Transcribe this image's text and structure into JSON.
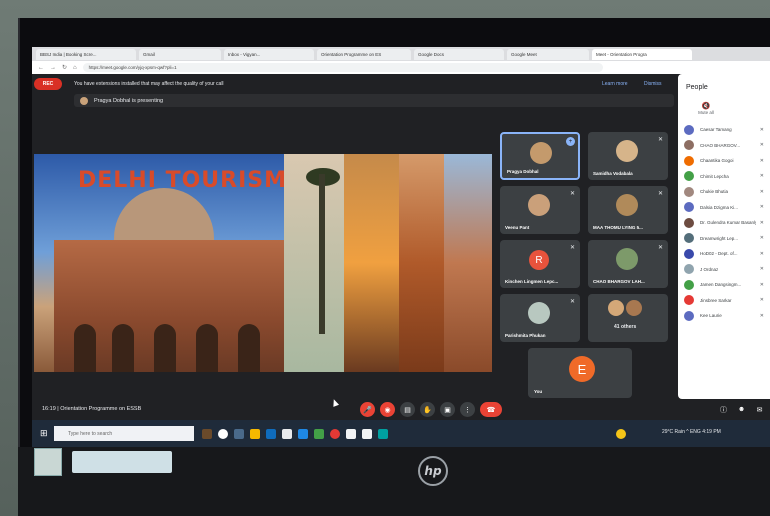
{
  "browser": {
    "tabs": [
      {
        "label": "BBSJ India | Booking Scre..."
      },
      {
        "label": "Gmail"
      },
      {
        "label": "Inbox - Vigyan..."
      },
      {
        "label": "Orientation Programme on ES"
      },
      {
        "label": "Google Docs"
      },
      {
        "label": "Google Meet"
      },
      {
        "label": "Meet - Orientation Progra"
      }
    ],
    "url": "https://meet.google.com/yjq-xpsm-qwf?pli=1"
  },
  "meet": {
    "rec_label": "REC",
    "notice_text": "You have extensions installed that may affect the quality of your call",
    "notice_learn_more": "Learn more",
    "notice_dismiss": "Dismiss",
    "presenting_text": "Pragya Dobhal is presenting",
    "slide_title": "DELHI TOURISM",
    "meeting_info": "16:19  |  Orientation Programme on ESSB"
  },
  "tiles": [
    {
      "name": "Pragya Dobhal"
    },
    {
      "name": "Samidha Vodabala"
    },
    {
      "name": "Veenu Pant"
    },
    {
      "name": "MAA THOMU LYING 5..."
    },
    {
      "name": "Kinchen Lingmen Lepc...",
      "letter": "R"
    },
    {
      "name": "CHAO BHARGOV LAH..."
    },
    {
      "name": "Parishmita Phukan"
    },
    {
      "name": "",
      "count": "41 others"
    }
  ],
  "you_tile": {
    "name": "You",
    "letter": "E"
  },
  "people_panel": {
    "title": "People",
    "mute_all": "Mute all",
    "participants": [
      {
        "name": "Caesar Tamang",
        "color": "#5c6bc0"
      },
      {
        "name": "CHAO BHARGOV...",
        "color": "#8d6e63"
      },
      {
        "name": "Chaantika Gogoi",
        "color": "#ef6c00"
      },
      {
        "name": "Chimit Lepcha",
        "color": "#43a047"
      },
      {
        "name": "Chukie Bhutia",
        "color": "#a1887f"
      },
      {
        "name": "Dalsia Dzigma Ki...",
        "color": "#5c6bc0"
      },
      {
        "name": "Dr. Gulendra Kumar Basanlyngdoh",
        "color": "#6d4c41"
      },
      {
        "name": "Dreamwright Lep...",
        "color": "#546e7a"
      },
      {
        "name": "HoD02 - Dept. of...",
        "color": "#3949ab"
      },
      {
        "name": "J Ordnaz",
        "color": "#90a4ae"
      },
      {
        "name": "Jamen Dangsingm...",
        "color": "#43a047"
      },
      {
        "name": "Jinsbree Sarkar",
        "color": "#e53935"
      },
      {
        "name": "Kee Laurie",
        "color": "#5c6bc0"
      }
    ]
  },
  "taskbar": {
    "search_placeholder": "Type here to search",
    "tray_text": "29°C Rain  ^  ENG  4:19 PM"
  },
  "device": {
    "brand": "hp"
  }
}
